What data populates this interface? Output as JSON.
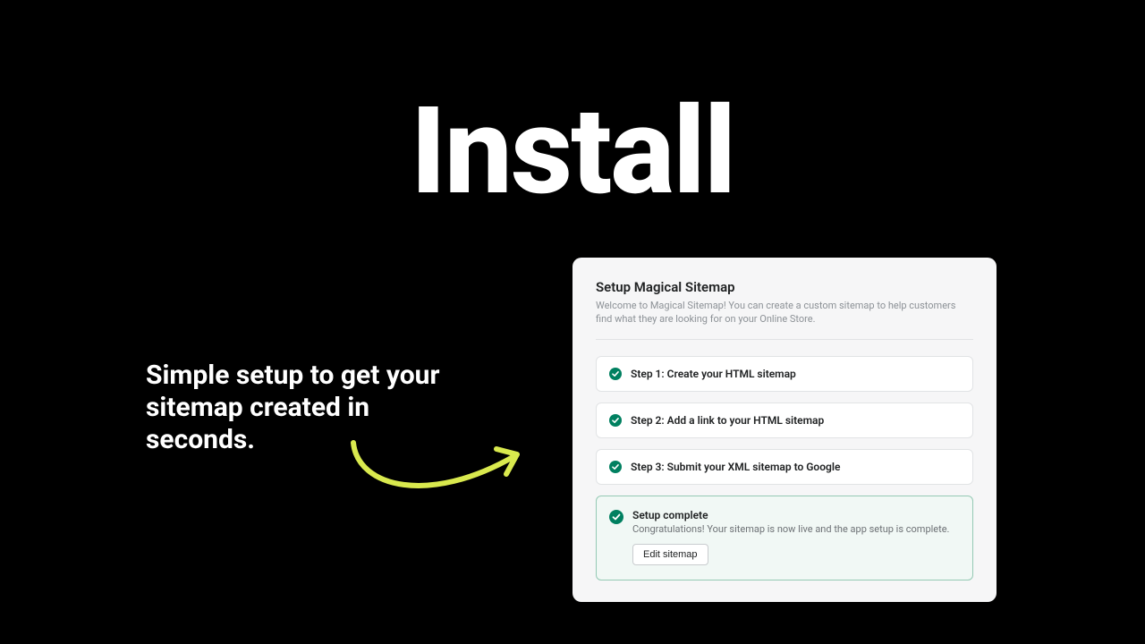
{
  "hero": {
    "title": "Install",
    "subtitle": "Simple setup to get your sitemap created in seconds."
  },
  "card": {
    "title": "Setup Magical Sitemap",
    "description": "Welcome to Magical Sitemap! You can create a custom sitemap to help customers find what they are looking for on your Online Store.",
    "steps": [
      {
        "label": "Step 1: Create your HTML sitemap"
      },
      {
        "label": "Step 2: Add a link to your HTML sitemap"
      },
      {
        "label": "Step 3: Submit your XML sitemap to Google"
      }
    ],
    "complete": {
      "title": "Setup complete",
      "description": "Congratulations! Your sitemap is now live and the app setup is complete.",
      "button": "Edit sitemap"
    }
  },
  "colors": {
    "accent_green": "#008060",
    "arrow": "#d9e94e"
  }
}
